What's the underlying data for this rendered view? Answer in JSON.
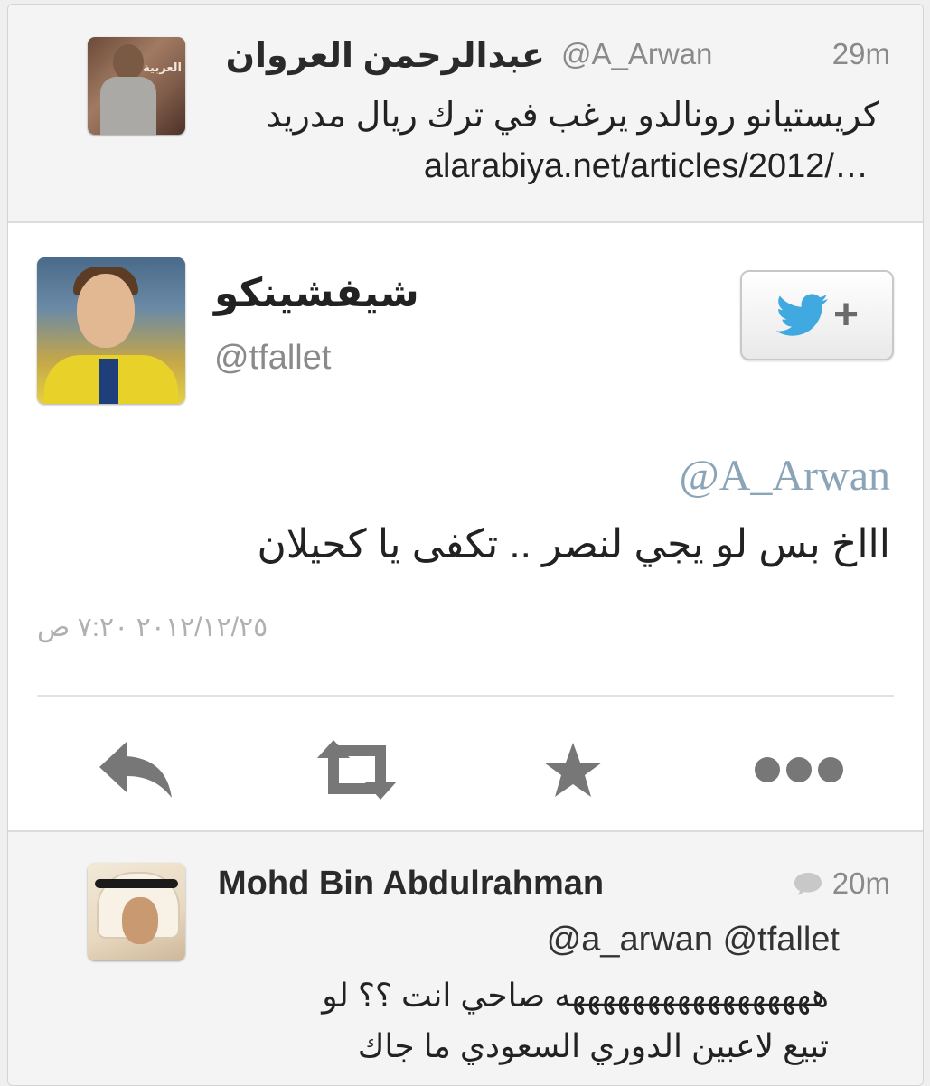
{
  "top_tweet": {
    "name": "عبدالرحمن العروان",
    "handle": "@A_Arwan",
    "time": "29m",
    "text": "كريستيانو رونالدو يرغب في ترك ريال مدريد",
    "link": "alarabiya.net/articles/2012/…",
    "avatar_logo_text": "العربية"
  },
  "main_tweet": {
    "name": "شيفشينكو",
    "handle": "@tfallet",
    "follow_label": "+",
    "mention": "@A_Arwan",
    "text": "اااخ بس لو يجي لنصر .. تكفى يا كحيلان",
    "date": "٢٠١٢/١٢/٢٥ ٧:٢٠ ص",
    "actions": {
      "reply": "reply",
      "retweet": "retweet",
      "favorite": "favorite",
      "more": "more"
    },
    "twitter_color": "#3fa9e0"
  },
  "bottom_tweet": {
    "name": "Mohd Bin Abdulrahman",
    "time": "20m",
    "mentions": "@a_arwan @tfallet",
    "text_line1": "هههههههههههههههههه صاحي انت ؟؟ لو",
    "text_line2": "تبيع لاعبين الدوري السعودي ما جاك"
  }
}
